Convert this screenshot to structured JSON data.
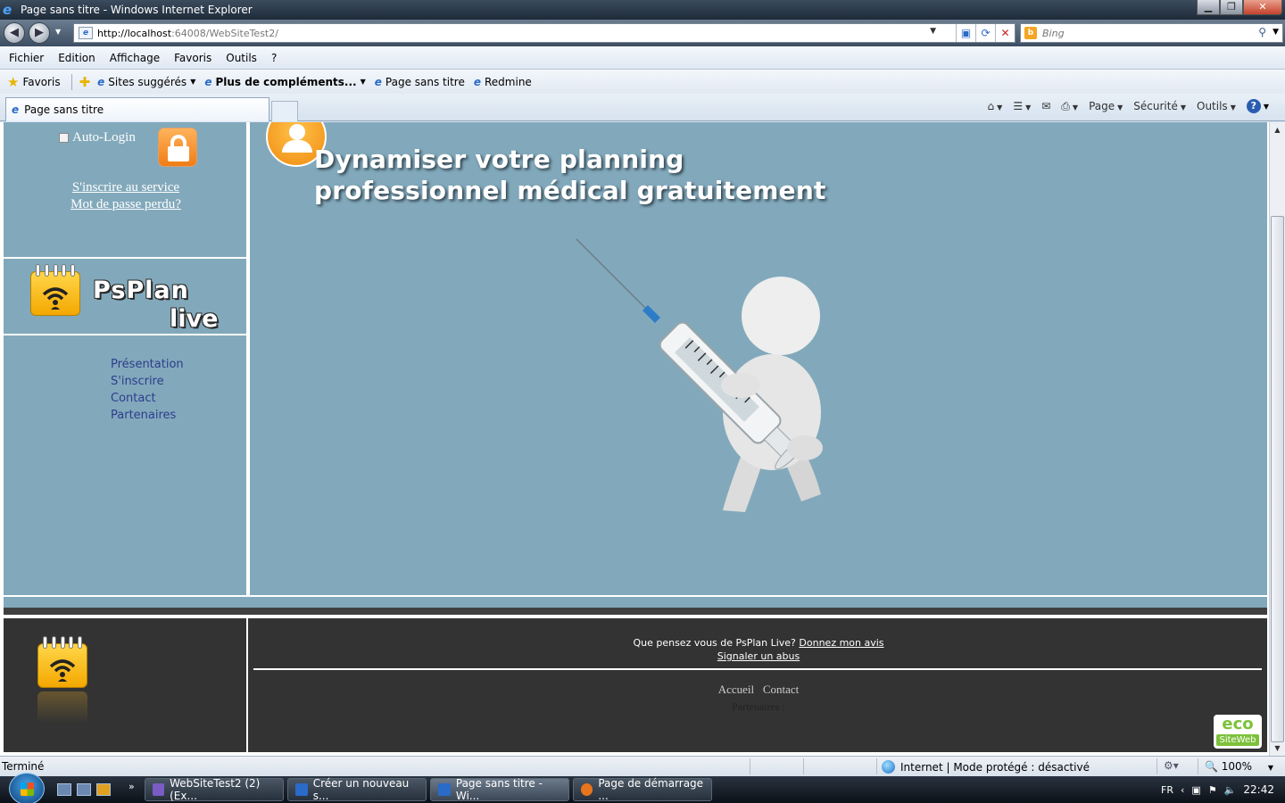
{
  "window": {
    "title": "Page sans titre - Windows Internet Explorer"
  },
  "address": {
    "url_host": "http://localhost",
    "url_rest": ":64008/WebSiteTest2/"
  },
  "search": {
    "placeholder": "Bing"
  },
  "menu": [
    "Fichier",
    "Edition",
    "Affichage",
    "Favoris",
    "Outils",
    "?"
  ],
  "favorites": {
    "label": "Favoris",
    "items": [
      "Sites suggérés",
      "Plus de compléments...",
      "Page sans titre",
      "Redmine"
    ]
  },
  "tab": {
    "title": "Page sans titre"
  },
  "commandbar": {
    "page": "Page",
    "security": "Sécurité",
    "tools": "Outils"
  },
  "login": {
    "autologin": "Auto-Login",
    "signup_link": "S'inscrire au service",
    "forgot_link": "Mot de passe perdu?"
  },
  "logo": {
    "line1": "PsPlan",
    "line2": "live"
  },
  "sidenav": [
    "Présentation",
    "S'inscrire",
    "Contact",
    "Partenaires"
  ],
  "hero": {
    "headline_line1": "Dynamiser votre planning",
    "headline_line2": "professionnel médical gratuitement"
  },
  "footer": {
    "question": "Que pensez vous de PsPlan Live?",
    "feedback_link": "Donnez mon avis",
    "abuse_link": "Signaler un abus",
    "nav_home": "Accueil",
    "nav_contact": "Contact",
    "partners": "Partenaires :",
    "eco_line1": "eco",
    "eco_line2": "SiteWeb"
  },
  "status": {
    "text": "Terminé",
    "zone": "Internet | Mode protégé : désactivé",
    "zoom": "100%"
  },
  "taskbar": {
    "buttons": [
      "WebSiteTest2 (2) (Ex...",
      "Créer un nouveau s...",
      "Page sans titre - Wi...",
      "Page de démarrage ..."
    ],
    "lang": "FR",
    "time": "22:42"
  }
}
